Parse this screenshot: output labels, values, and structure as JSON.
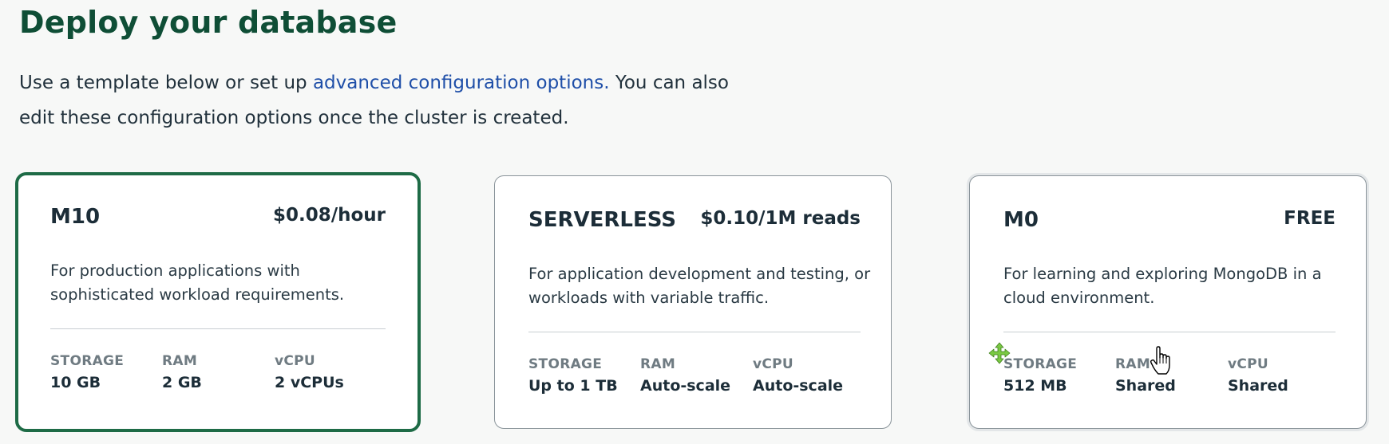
{
  "page": {
    "title": "Deploy your database",
    "intro_before_link": "Use a template below or set up ",
    "intro_link": "advanced configuration options.",
    "intro_after_link": " You can also edit these configuration options once the cluster is created."
  },
  "cards": [
    {
      "tier": "M10",
      "price": "$0.08/hour",
      "description": "For production applications with sophisticated workload requirements.",
      "selected": true,
      "specs": [
        {
          "label": "STORAGE",
          "value": "10 GB"
        },
        {
          "label": "RAM",
          "value": "2 GB"
        },
        {
          "label": "vCPU",
          "value": "2 vCPUs"
        }
      ]
    },
    {
      "tier": "SERVERLESS",
      "price": "$0.10/1M reads",
      "description": "For application development and testing, or workloads with variable traffic.",
      "selected": false,
      "specs": [
        {
          "label": "STORAGE",
          "value": "Up to 1 TB"
        },
        {
          "label": "RAM",
          "value": "Auto-scale"
        },
        {
          "label": "vCPU",
          "value": "Auto-scale"
        }
      ]
    },
    {
      "tier": "M0",
      "price": "FREE",
      "description": "For learning and exploring MongoDB in a cloud environment.",
      "selected": false,
      "specs": [
        {
          "label": "STORAGE",
          "value": "512 MB"
        },
        {
          "label": "RAM",
          "value": "Shared"
        },
        {
          "label": "vCPU",
          "value": "Shared"
        }
      ]
    }
  ],
  "icons": {
    "move": "move-cursor-icon",
    "pointer": "hand-pointer-icon"
  },
  "colors": {
    "title": "#0f4e36",
    "link": "#1f4fa8",
    "selected_border": "#1e6b46",
    "move_icon": "#7ac943"
  }
}
